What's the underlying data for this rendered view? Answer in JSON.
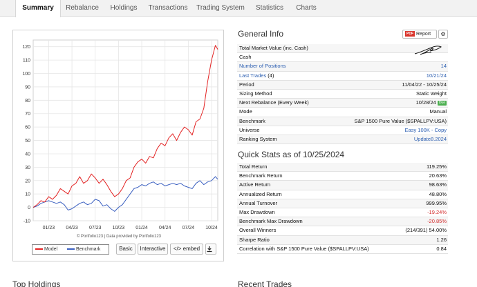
{
  "tabs": [
    {
      "label": "Summary",
      "active": true
    },
    {
      "label": "Rebalance"
    },
    {
      "label": "Holdings"
    },
    {
      "label": "Transactions"
    },
    {
      "label": "Trading System"
    },
    {
      "label": "Statistics"
    },
    {
      "label": "Charts"
    }
  ],
  "general_info": {
    "title": "General Info",
    "report_label": "Report",
    "pdf_badge": "PDF",
    "rows": [
      {
        "label": "Total Market Value (inc. Cash)",
        "value": ""
      },
      {
        "label": "Cash",
        "value": ""
      },
      {
        "label": "Number of Positions",
        "value": "14"
      },
      {
        "label": "Last Trades",
        "count": "(4)",
        "value": "10/21/24"
      },
      {
        "label": "Period",
        "value": "11/04/22 - 10/25/24"
      },
      {
        "label": "Sizing Method",
        "value": "Static Weight"
      },
      {
        "label": "Next Rebalance (Every Week)",
        "value": "10/28/24",
        "badge": "Due"
      },
      {
        "label": "Mode",
        "value": "Manual"
      },
      {
        "label": "Benchmark",
        "value": "S&P 1500 Pure Value ($SPALLPV:USA)"
      },
      {
        "label": "Universe",
        "value": "Easy 100K - Copy"
      },
      {
        "label": "Ranking System",
        "value": "Update8.2024"
      }
    ]
  },
  "quick_stats": {
    "title": "Quick Stats as of 10/25/2024",
    "rows": [
      {
        "label": "Total Return",
        "value": "119.25%"
      },
      {
        "label": "Benchmark Return",
        "value": "20.63%"
      },
      {
        "label": "Active Return",
        "value": "98.63%"
      },
      {
        "label": "Annualized Return",
        "value": "48.80%"
      },
      {
        "label": "Annual Turnover",
        "value": "999.95%"
      },
      {
        "label": "Max Drawdown",
        "value": "-19.24%"
      },
      {
        "label": "Benchmark Max Drawdown",
        "value": "-20.85%"
      },
      {
        "label": "Overall Winners",
        "value": "(214/391) 54.00%"
      },
      {
        "label": "Sharpe Ratio",
        "value": "1.26"
      },
      {
        "label": "Correlation with S&P 1500 Pure Value ($SPALLPV:USA)",
        "value": "0.84"
      }
    ]
  },
  "chart_panel": {
    "credit": "© Portfolio123 | Data provided by Portfolio123",
    "buttons": {
      "basic": "Basic",
      "interactive": "Interactive",
      "embed": "</> embed",
      "download_icon": "download-icon"
    }
  },
  "sections": {
    "top_holdings": "Top Holdings",
    "recent_trades": "Recent Trades"
  },
  "chart_data": {
    "type": "line",
    "ylim": [
      -10,
      125
    ],
    "yticks": [
      -10,
      0,
      10,
      20,
      30,
      40,
      50,
      60,
      70,
      80,
      90,
      100,
      110,
      120
    ],
    "xticks": [
      {
        "t": 2.0,
        "label": "01/23"
      },
      {
        "t": 5.0,
        "label": "04/23"
      },
      {
        "t": 8.0,
        "label": "07/23"
      },
      {
        "t": 11.0,
        "label": "10/23"
      },
      {
        "t": 14.0,
        "label": "01/24"
      },
      {
        "t": 17.0,
        "label": "04/24"
      },
      {
        "t": 20.0,
        "label": "07/24"
      },
      {
        "t": 23.0,
        "label": "10/24"
      }
    ],
    "xrange": [
      0,
      23.8
    ],
    "series": [
      {
        "name": "Model",
        "color": "#e32222",
        "x": [
          0,
          0.5,
          1,
          1.5,
          2,
          2.5,
          3,
          3.5,
          4,
          4.5,
          5,
          5.5,
          6,
          6.5,
          7,
          7.5,
          8,
          8.5,
          9,
          9.5,
          10,
          10.5,
          11,
          11.5,
          12,
          12.5,
          13,
          13.5,
          14,
          14.5,
          15,
          15.5,
          16,
          16.5,
          17,
          17.5,
          18,
          18.5,
          19,
          19.5,
          20,
          20.5,
          21,
          21.5,
          22,
          22.5,
          23,
          23.5,
          23.8
        ],
        "values": [
          0,
          2,
          5,
          4,
          8,
          6,
          9,
          14,
          12,
          10,
          16,
          18,
          23,
          18,
          20,
          25,
          22,
          18,
          21,
          17,
          12,
          8,
          10,
          14,
          20,
          22,
          30,
          34,
          36,
          33,
          38,
          37,
          44,
          48,
          46,
          52,
          55,
          50,
          56,
          60,
          58,
          54,
          64,
          66,
          74,
          94,
          110,
          121,
          118
        ]
      },
      {
        "name": "Benchmark",
        "color": "#3a5fc0",
        "x": [
          0,
          0.5,
          1,
          1.5,
          2,
          2.5,
          3,
          3.5,
          4,
          4.5,
          5,
          5.5,
          6,
          6.5,
          7,
          7.5,
          8,
          8.5,
          9,
          9.5,
          10,
          10.5,
          11,
          11.5,
          12,
          12.5,
          13,
          13.5,
          14,
          14.5,
          15,
          15.5,
          16,
          16.5,
          17,
          17.5,
          18,
          18.5,
          19,
          19.5,
          20,
          20.5,
          21,
          21.5,
          22,
          22.5,
          23,
          23.5,
          23.8
        ],
        "values": [
          0,
          1,
          3,
          4,
          5,
          4,
          3,
          4,
          2,
          -2,
          -1,
          1,
          3,
          4,
          2,
          3,
          6,
          5,
          1,
          2,
          -1,
          -3,
          0,
          2,
          6,
          10,
          14,
          15,
          17,
          16,
          18,
          19,
          17,
          18,
          16,
          17,
          18,
          17,
          18,
          16,
          15,
          14,
          18,
          20,
          17,
          19,
          20,
          23,
          21
        ]
      }
    ]
  }
}
